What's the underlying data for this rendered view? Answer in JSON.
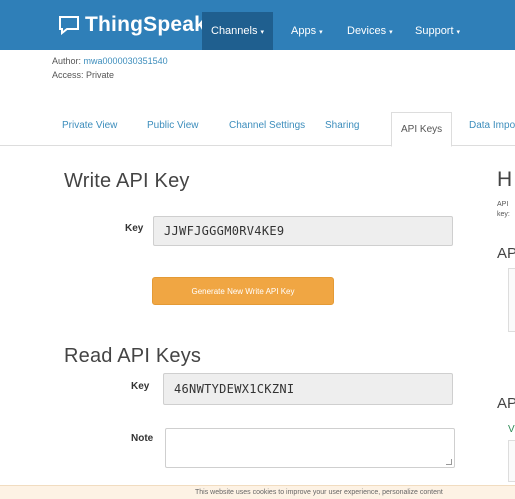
{
  "navbar": {
    "brand": "ThingSpeak",
    "brand_tm": "™",
    "items": [
      {
        "label": "Channels",
        "caret": "▾"
      },
      {
        "label": "Apps",
        "caret": "▾"
      },
      {
        "label": "Devices",
        "caret": "▾"
      },
      {
        "label": "Support",
        "caret": "▾"
      }
    ]
  },
  "meta": {
    "author_label": "Author:",
    "author_value": "mwa0000030351540",
    "access": "Access: Private"
  },
  "tabs": [
    "Private View",
    "Public View",
    "Channel Settings",
    "Sharing",
    "API Keys",
    "Data Impo"
  ],
  "write_section": {
    "title": "Write API Key",
    "key_label": "Key",
    "key_value": "JJWFJGGGM0RV4KE9",
    "generate_button": "Generate New Write API Key"
  },
  "read_section": {
    "title": "Read API Keys",
    "key_label": "Key",
    "key_value": "46NWTYDEWX1CKZNI",
    "note_label": "Note"
  },
  "side_panel": {
    "heading": "H",
    "text_line1": "API",
    "text_line2": "key:",
    "sub1": "AP",
    "sub2": "AP",
    "link": "V"
  },
  "cookie_bar": {
    "text": "This website uses cookies to improve your user experience, personalize content"
  },
  "colors": {
    "navbar": "#2f7fb8",
    "navbar_active": "#1f5f8f",
    "link": "#3c8dbc",
    "button": "#f0a643"
  }
}
